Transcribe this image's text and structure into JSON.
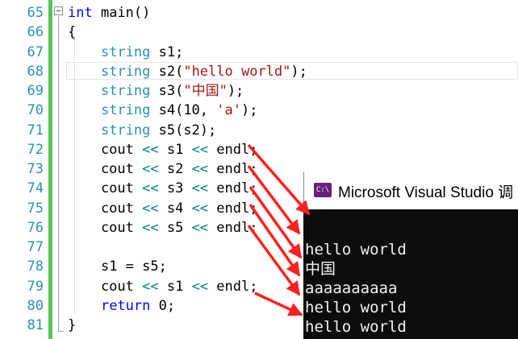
{
  "editor": {
    "line_numbers": [
      "65",
      "66",
      "67",
      "68",
      "69",
      "70",
      "71",
      "72",
      "73",
      "74",
      "75",
      "76",
      "77",
      "78",
      "79",
      "80",
      "81"
    ],
    "lines": [
      [
        {
          "c": "kw",
          "t": "int"
        },
        {
          "c": "",
          "t": " main()"
        }
      ],
      [
        {
          "c": "",
          "t": "{"
        }
      ],
      [
        {
          "c": "",
          "t": "    "
        },
        {
          "c": "ty",
          "t": "string"
        },
        {
          "c": "",
          "t": " s1;"
        }
      ],
      [
        {
          "c": "",
          "t": "    "
        },
        {
          "c": "ty",
          "t": "string"
        },
        {
          "c": "",
          "t": " s2("
        },
        {
          "c": "st",
          "t": "\"hello world\""
        },
        {
          "c": "",
          "t": ");"
        }
      ],
      [
        {
          "c": "",
          "t": "    "
        },
        {
          "c": "ty",
          "t": "string"
        },
        {
          "c": "",
          "t": " s3("
        },
        {
          "c": "st",
          "t": "\"中国\""
        },
        {
          "c": "",
          "t": ");"
        }
      ],
      [
        {
          "c": "",
          "t": "    "
        },
        {
          "c": "ty",
          "t": "string"
        },
        {
          "c": "",
          "t": " s4(10, "
        },
        {
          "c": "st",
          "t": "'a'"
        },
        {
          "c": "",
          "t": ");"
        }
      ],
      [
        {
          "c": "",
          "t": "    "
        },
        {
          "c": "ty",
          "t": "string"
        },
        {
          "c": "",
          "t": " s5(s2);"
        }
      ],
      [
        {
          "c": "",
          "t": "    cout "
        },
        {
          "c": "op",
          "t": "<<"
        },
        {
          "c": "",
          "t": " s1 "
        },
        {
          "c": "op",
          "t": "<<"
        },
        {
          "c": "",
          "t": " endl;"
        }
      ],
      [
        {
          "c": "",
          "t": "    cout "
        },
        {
          "c": "op",
          "t": "<<"
        },
        {
          "c": "",
          "t": " s2 "
        },
        {
          "c": "op",
          "t": "<<"
        },
        {
          "c": "",
          "t": " endl;"
        }
      ],
      [
        {
          "c": "",
          "t": "    cout "
        },
        {
          "c": "op",
          "t": "<<"
        },
        {
          "c": "",
          "t": " s3 "
        },
        {
          "c": "op",
          "t": "<<"
        },
        {
          "c": "",
          "t": " endl;"
        }
      ],
      [
        {
          "c": "",
          "t": "    cout "
        },
        {
          "c": "op",
          "t": "<<"
        },
        {
          "c": "",
          "t": " s4 "
        },
        {
          "c": "op",
          "t": "<<"
        },
        {
          "c": "",
          "t": " endl;"
        }
      ],
      [
        {
          "c": "",
          "t": "    cout "
        },
        {
          "c": "op",
          "t": "<<"
        },
        {
          "c": "",
          "t": " s5 "
        },
        {
          "c": "op",
          "t": "<<"
        },
        {
          "c": "",
          "t": " endl;"
        }
      ],
      [
        {
          "c": "",
          "t": ""
        }
      ],
      [
        {
          "c": "",
          "t": "    s1 = s5;"
        }
      ],
      [
        {
          "c": "",
          "t": "    cout "
        },
        {
          "c": "op",
          "t": "<<"
        },
        {
          "c": "",
          "t": " s1 "
        },
        {
          "c": "op",
          "t": "<<"
        },
        {
          "c": "",
          "t": " endl;"
        }
      ],
      [
        {
          "c": "",
          "t": "    "
        },
        {
          "c": "kw",
          "t": "return"
        },
        {
          "c": "",
          "t": " 0;"
        }
      ],
      [
        {
          "c": "",
          "t": "}"
        }
      ]
    ]
  },
  "console": {
    "icon_text": "C:\\",
    "title": "Microsoft Visual Studio 调",
    "output_lines": [
      "",
      "hello world",
      "中国",
      "aaaaaaaaaa",
      "hello world",
      "hello world"
    ]
  },
  "colors": {
    "arrow": "#ff2020",
    "change_bar": "#57c45e",
    "console_bg": "#0c0c0c"
  }
}
